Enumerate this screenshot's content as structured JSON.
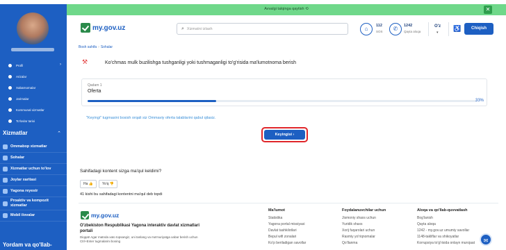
{
  "top_strip": {
    "text": ""
  },
  "banner": {
    "text": "Avvalgi talqinga qaytish"
  },
  "sidebar": {
    "personal_items": [
      {
        "label": "Profil",
        "has_chevron": true
      },
      {
        "label": "Arizalar",
        "has_chevron": false
      },
      {
        "label": "Xabarnomalar",
        "has_chevron": false
      },
      {
        "label": "Jarimalar",
        "has_chevron": false
      },
      {
        "label": "Kommunal xizmatlar",
        "has_chevron": false
      },
      {
        "label": "To'lovlar tarixi",
        "has_chevron": false
      }
    ],
    "section_title": "Xizmatlar",
    "section_items": [
      {
        "label": "Ommabop xizmatlar"
      },
      {
        "label": "Sohalar"
      },
      {
        "label": "Xizmatlar uchun to'lov"
      },
      {
        "label": "Joylar xaritasi"
      },
      {
        "label": "Yagona reyestr"
      },
      {
        "label": "Proaktiv va kompozit xizmatlar"
      },
      {
        "label": "Mobil ilovalar"
      }
    ],
    "bottom_title": "Yordam va qo'llab-"
  },
  "header": {
    "logo": "my.gov.uz",
    "search_placeholder": "Xizmatni izlash",
    "sos_number": "112",
    "sos_label": "SOS",
    "callback_number": "1242",
    "callback_label": "Qayta aloqa",
    "language": "O'z",
    "logout": "Chiqish"
  },
  "breadcrumb": [
    "Bosh sahifa",
    "Sohalar"
  ],
  "page_title": "Ko'chmas mulk buzilishga tushganligi yoki tushmaganligi to'g'risida ma'lumotnoma berish",
  "step": {
    "number": "Qadam 1",
    "name": "Oferta",
    "progress": 0.33,
    "percent_label": "33%"
  },
  "note": "\"Keyingi\" tugmasini bosish orqali siz Ommaviy oferta talablarini qabul qilasiz.",
  "next_button": "Keyingisi",
  "feedback": {
    "question": "Sahifadagi kontent sizga ma'qul keldimi?",
    "yes": "Ha",
    "no": "Yo'q",
    "count_text": "41 kishi bu sahifadagi kontentni ma'qul deb topdi"
  },
  "footer": {
    "logo": "my.gov.uz",
    "title": "O'zbekiston Respublikasi Yagona interaktiv davlat xizmatlari portali",
    "note": "Diqqat! Agar matnda xato topsangiz, uni tanlang va ma'muriyatga xabar berish uchun Ctrl+Enter tugmalarini bosing",
    "columns": [
      {
        "heading": "Ma'lumot",
        "links": [
          "Statistika",
          "Yagona portal missiyasi",
          "Davlat tashkilotlari",
          "Bepul wifi zonalari",
          "Ko'p beriladigan savollar"
        ]
      },
      {
        "heading": "Foydalanuvchilar uchun",
        "links": [
          "Jismoniy shaxs uchun",
          "Yuridik shaxs",
          "Xorij fuqarolari uchun",
          "Rasmiy yo'riqnomalar",
          "Qo'llanma"
        ]
      },
      {
        "heading": "Aloqa va qo'llab-quvvatlash",
        "links": [
          "Bog'lanish",
          "Qayta aloqa",
          "1242 - my.gov.uz umumiy savollar",
          "1148-takliflar va shikoyatlar",
          "Korrupsiya to'g'risida onlayn murojaat"
        ]
      }
    ]
  },
  "colors": {
    "primary": "#1d5fc2",
    "banner": "#6fd88a",
    "highlight": "#e0262a"
  },
  "icons": [
    "close-icon",
    "search-icon",
    "sos-icon",
    "phone-icon",
    "accessibility-icon",
    "chat-icon",
    "thumbs-up-icon",
    "thumbs-down-icon",
    "service-icon"
  ]
}
